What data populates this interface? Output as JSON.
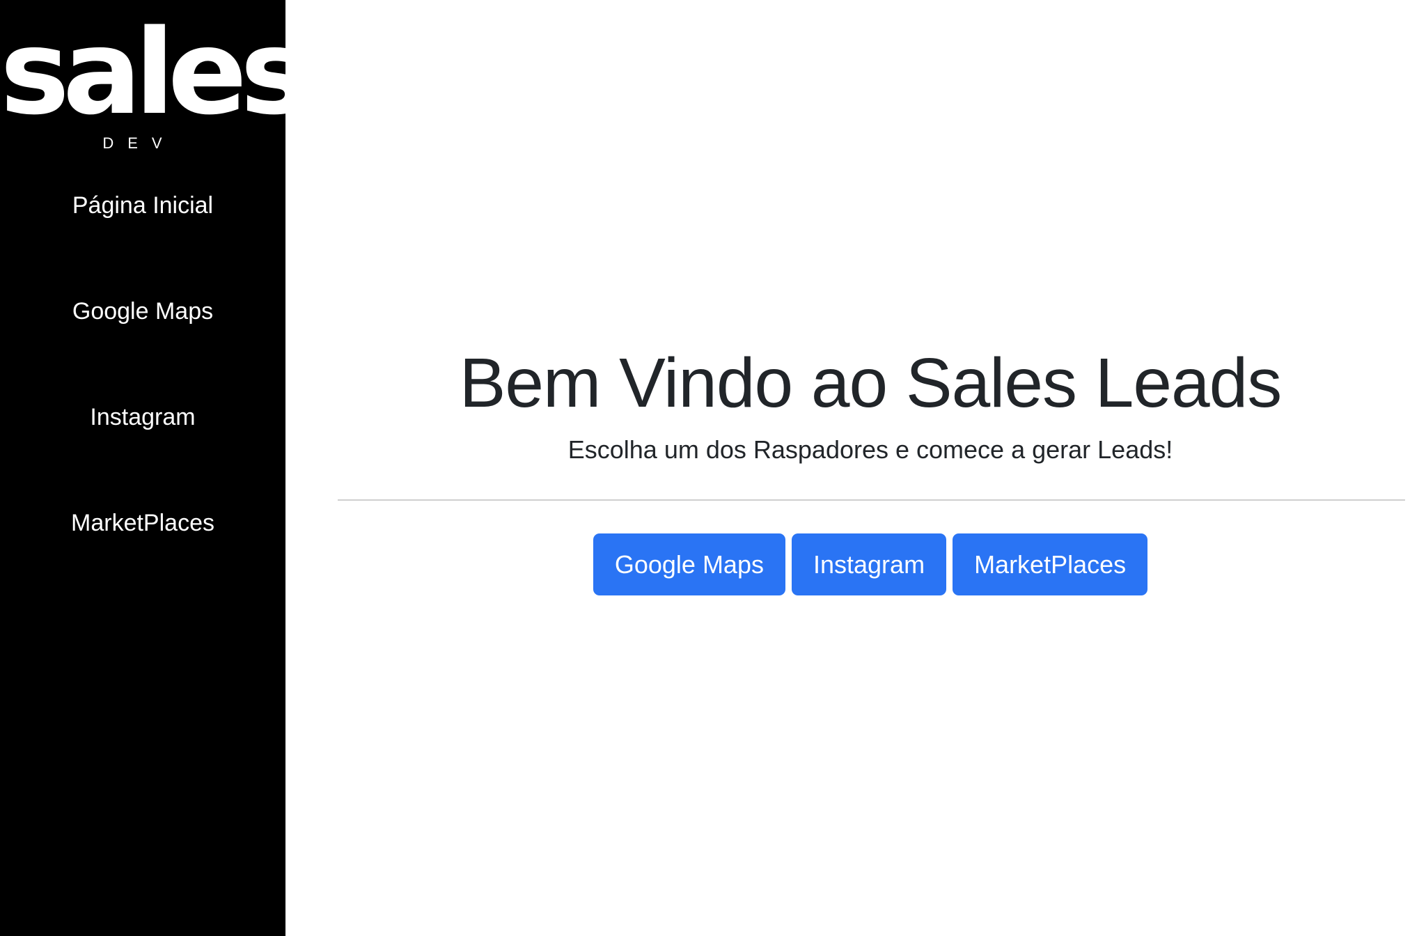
{
  "sidebar": {
    "logo": {
      "main": "sales",
      "sub": "DEV"
    },
    "items": [
      {
        "label": "Página Inicial"
      },
      {
        "label": "Google Maps"
      },
      {
        "label": "Instagram"
      },
      {
        "label": "MarketPlaces"
      }
    ]
  },
  "main": {
    "title": "Bem Vindo ao Sales Leads",
    "subtitle": "Escolha um dos Raspadores e comece a gerar Leads!",
    "buttons": [
      {
        "label": "Google Maps"
      },
      {
        "label": "Instagram"
      },
      {
        "label": "MarketPlaces"
      }
    ]
  },
  "colors": {
    "sidebar_background": "#000000",
    "button_primary": "#2a74f4",
    "text_dark": "#212529",
    "divider": "#cfcfcf"
  }
}
